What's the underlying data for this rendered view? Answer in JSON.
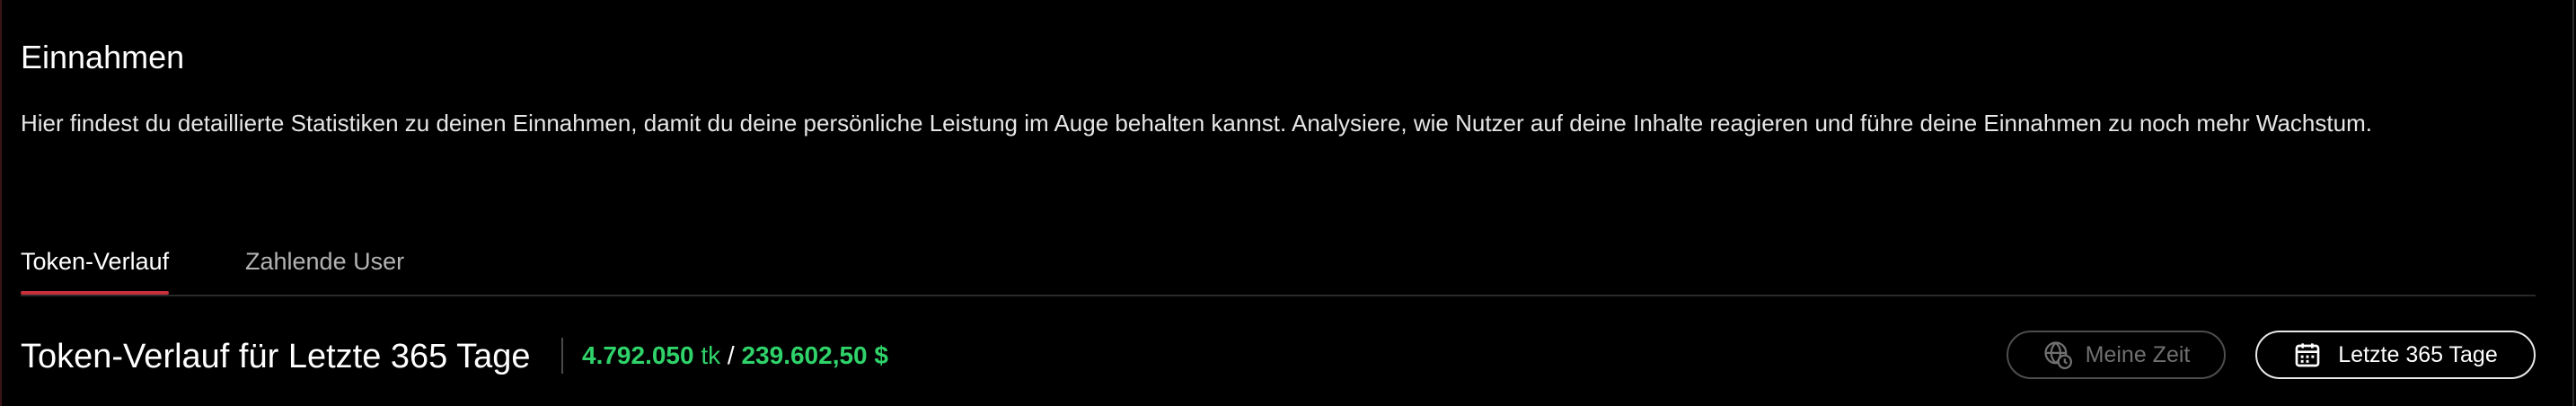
{
  "page": {
    "title": "Einnahmen",
    "description": "Hier findest du detaillierte Statistiken zu deinen Einnahmen, damit du deine persönliche Leistung im Auge behalten kannst. Analysiere, wie Nutzer auf deine Inhalte reagieren und führe deine Einnahmen zu noch mehr Wachstum."
  },
  "tabs": [
    {
      "label": "Token-Verlauf",
      "active": true
    },
    {
      "label": "Zahlende User",
      "active": false
    }
  ],
  "section": {
    "title": "Token-Verlauf für Letzte 365 Tage",
    "tokens_value": "4.792.050",
    "tokens_unit": "tk",
    "separator": "/",
    "money_value": "239.602,50 $"
  },
  "buttons": {
    "my_time": {
      "label": "Meine Zeit",
      "icon": "globe-clock-icon",
      "enabled": false
    },
    "date_range": {
      "label": "Letzte 365 Tage",
      "icon": "calendar-icon"
    }
  },
  "colors": {
    "background": "#000000",
    "accent_underline": "#c8303c",
    "positive": "#2fd36a",
    "text_primary": "#ffffff",
    "text_muted": "#b3b3b3",
    "disabled": "#707070"
  }
}
